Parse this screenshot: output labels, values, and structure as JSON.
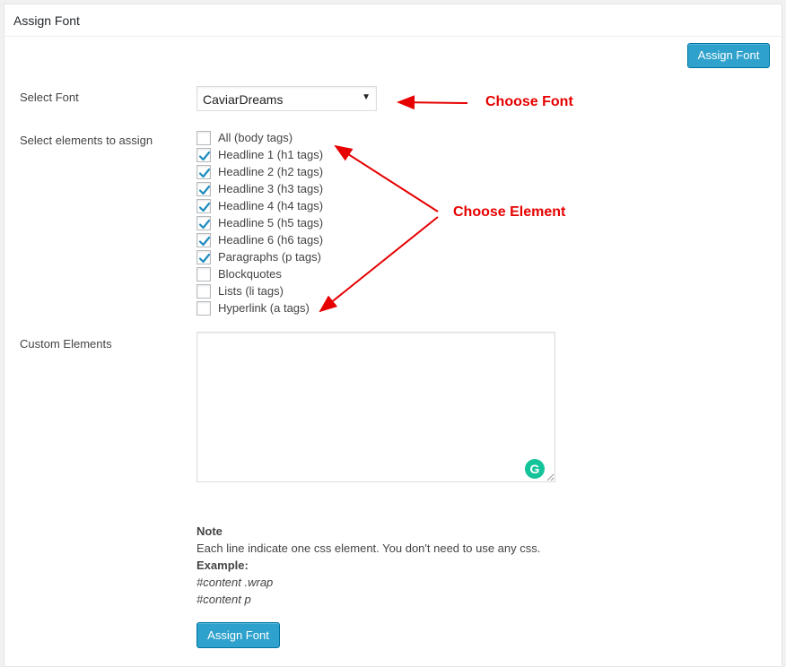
{
  "panel": {
    "title": "Assign Font",
    "assign_button_top": "Assign Font",
    "assign_button_bottom": "Assign Font"
  },
  "form": {
    "select_font_label": "Select Font",
    "select_font_value": "CaviarDreams",
    "select_elements_label": "Select elements to assign",
    "elements": [
      {
        "label": "All (body tags)",
        "checked": false
      },
      {
        "label": "Headline 1 (h1 tags)",
        "checked": true
      },
      {
        "label": "Headline 2 (h2 tags)",
        "checked": true
      },
      {
        "label": "Headline 3 (h3 tags)",
        "checked": true
      },
      {
        "label": "Headline 4 (h4 tags)",
        "checked": true
      },
      {
        "label": "Headline 5 (h5 tags)",
        "checked": true
      },
      {
        "label": "Headline 6 (h6 tags)",
        "checked": true
      },
      {
        "label": "Paragraphs (p tags)",
        "checked": true
      },
      {
        "label": "Blockquotes",
        "checked": false
      },
      {
        "label": "Lists (li tags)",
        "checked": false
      },
      {
        "label": "Hyperlink (a tags)",
        "checked": false
      }
    ],
    "custom_elements_label": "Custom Elements",
    "custom_elements_value": ""
  },
  "note": {
    "title": "Note",
    "text": "Each line indicate one css element. You don't need to use any css.",
    "example_label": "Example:",
    "example_lines": [
      "#content .wrap",
      "#content p"
    ]
  },
  "annotations": {
    "choose_font": "Choose Font",
    "choose_element": "Choose Element",
    "color": "#e60000"
  },
  "colors": {
    "button_bg": "#2ea2cc",
    "check_color": "#1e8cbe",
    "grammarly": "#15c39a"
  }
}
